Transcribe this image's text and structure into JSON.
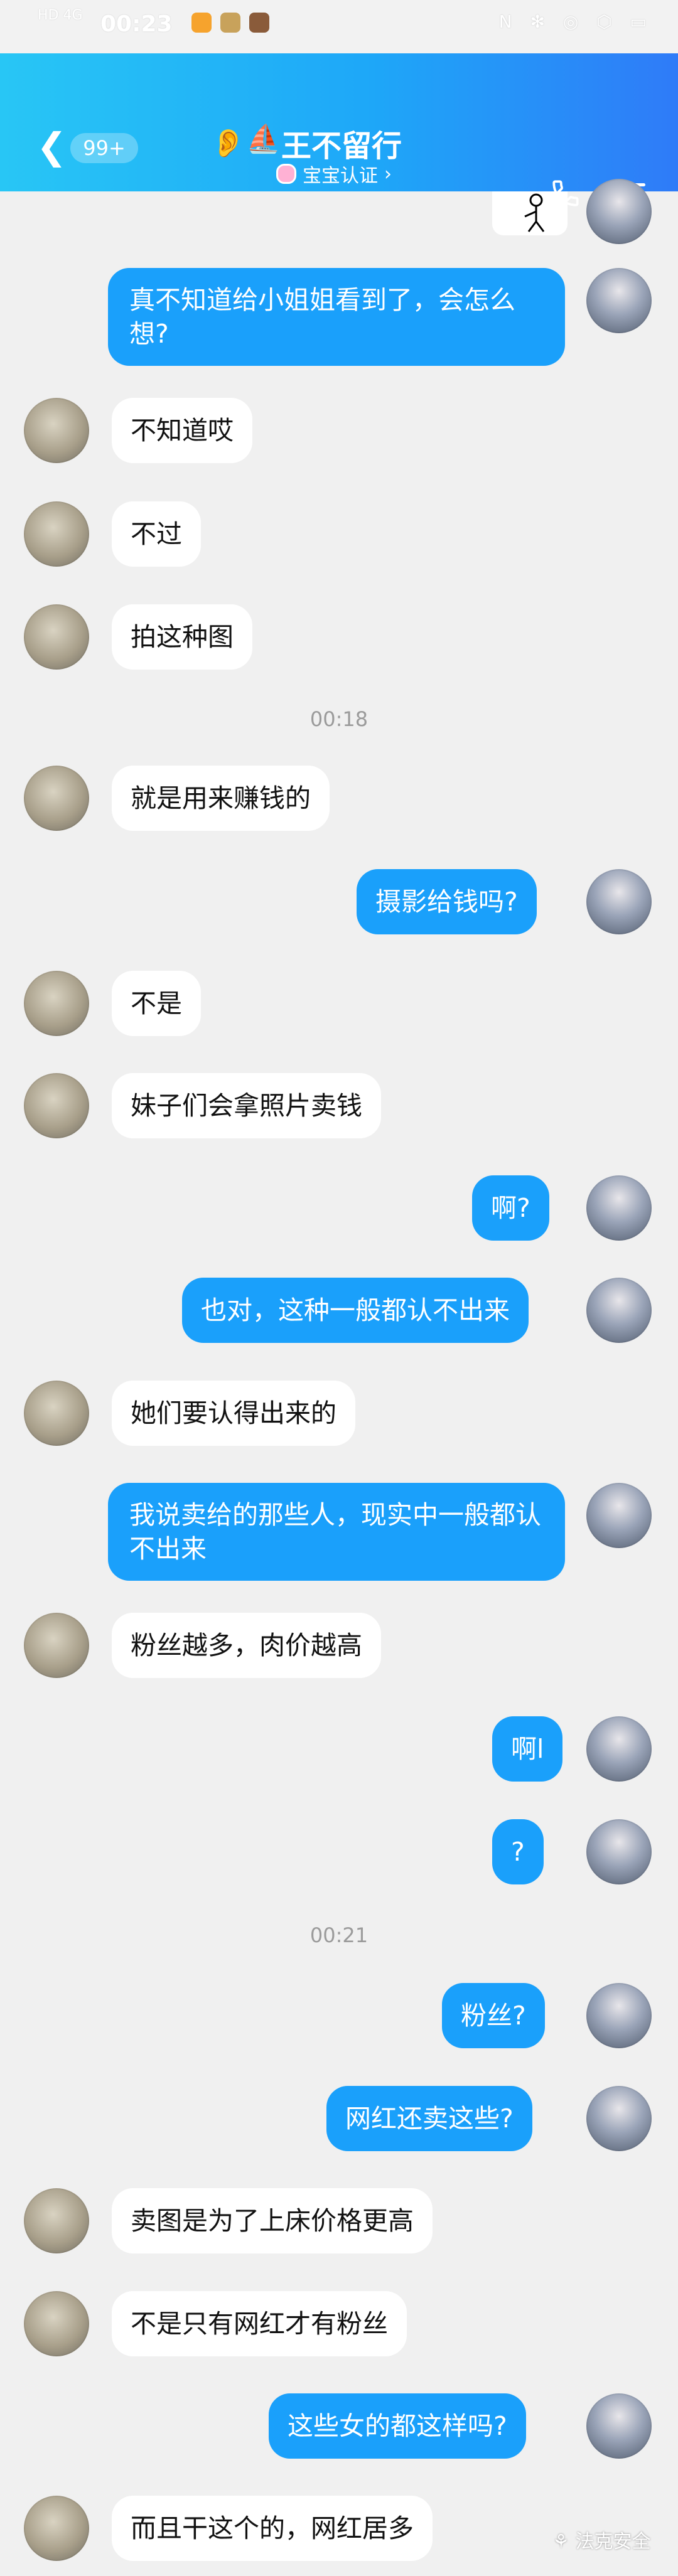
{
  "status_bar": {
    "network": "HD 4G",
    "time": "00:23",
    "right_icons": "N ✻ ◎ ⬡ ▭"
  },
  "header": {
    "back_icon": "chevron-left",
    "unread_badge": "99+",
    "contact_name": "王不留行",
    "contact_emoji": "⛵",
    "ear_icon": "ear-icon",
    "subtitle": "宝宝认证",
    "subtitle_arrow": "›",
    "colors": {
      "gradient_start": "#28c6f5",
      "gradient_end": "#2f7bf8"
    }
  },
  "messages": [
    {
      "from": "me",
      "text": "真不知道给小姐姐看到了，会怎么想?"
    },
    {
      "from": "them",
      "text": "不知道哎"
    },
    {
      "from": "them",
      "text": "不过"
    },
    {
      "from": "them",
      "text": "拍这种图"
    },
    {
      "time": "00:18"
    },
    {
      "from": "them",
      "text": "就是用来赚钱的"
    },
    {
      "from": "me",
      "text": "摄影给钱吗?"
    },
    {
      "from": "them",
      "text": "不是"
    },
    {
      "from": "them",
      "text": "妹子们会拿照片卖钱"
    },
    {
      "from": "me",
      "text": "啊?"
    },
    {
      "from": "me",
      "text": "也对，这种一般都认不出来"
    },
    {
      "from": "them",
      "text": "她们要认得出来的"
    },
    {
      "from": "me",
      "text": "我说卖给的那些人，现实中一般都认不出来"
    },
    {
      "from": "them",
      "text": "粉丝越多，肉价越高"
    },
    {
      "from": "me",
      "text": "啊l"
    },
    {
      "from": "me",
      "text": "?"
    },
    {
      "time": "00:21"
    },
    {
      "from": "me",
      "text": "粉丝?"
    },
    {
      "from": "me",
      "text": "网红还卖这些?"
    },
    {
      "from": "them",
      "text": "卖图是为了上床价格更高"
    },
    {
      "from": "them",
      "text": "不是只有网红才有粉丝"
    },
    {
      "from": "me",
      "text": "这些女的都这样吗?"
    },
    {
      "from": "them",
      "text": "而且干这个的，网红居多"
    }
  ],
  "watermark": "法克安全",
  "colors": {
    "outgoing_bubble": "#1aa0fb",
    "incoming_bubble": "#ffffff",
    "background": "#f0f0f0"
  }
}
